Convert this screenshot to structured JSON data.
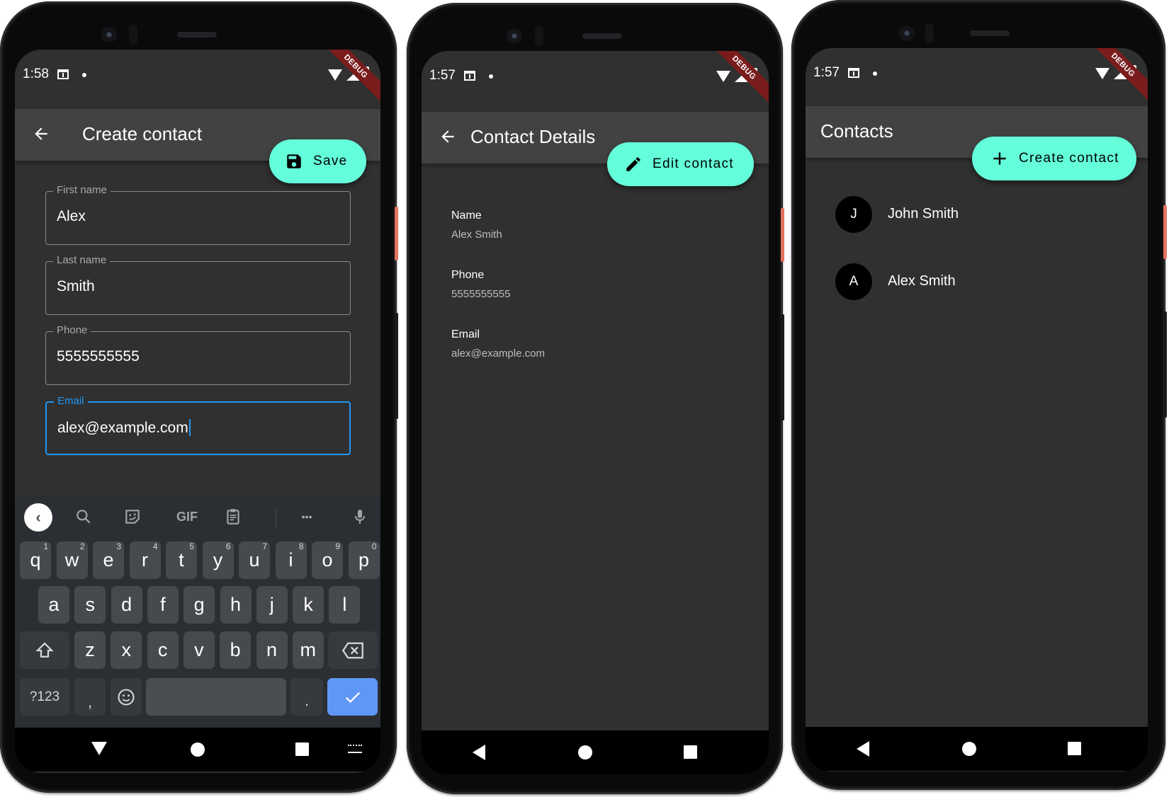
{
  "colors": {
    "accent": "#64ffda",
    "focus": "#2196f3",
    "background": "#303030",
    "appbar": "#424242",
    "debug_banner": "#7a1c1c",
    "keyboard_enter": "#5e97f6"
  },
  "create_screen": {
    "status": {
      "time": "1:58",
      "debug": "DEBUG"
    },
    "appbar": {
      "title": "Create contact",
      "back_icon": "arrow-left-icon"
    },
    "fab": {
      "label": "Save",
      "icon": "save-icon"
    },
    "fields": [
      {
        "label": "First name",
        "value": "Alex"
      },
      {
        "label": "Last name",
        "value": "Smith"
      },
      {
        "label": "Phone",
        "value": "5555555555"
      },
      {
        "label": "Email",
        "value": "alex@example.com",
        "focused": true
      }
    ],
    "keyboard": {
      "toolbar": {
        "gif": "GIF",
        "more": "•••"
      },
      "row1": [
        {
          "k": "q",
          "h": "1"
        },
        {
          "k": "w",
          "h": "2"
        },
        {
          "k": "e",
          "h": "3"
        },
        {
          "k": "r",
          "h": "4"
        },
        {
          "k": "t",
          "h": "5"
        },
        {
          "k": "y",
          "h": "6"
        },
        {
          "k": "u",
          "h": "7"
        },
        {
          "k": "i",
          "h": "8"
        },
        {
          "k": "o",
          "h": "9"
        },
        {
          "k": "p",
          "h": "0"
        }
      ],
      "row2": [
        "a",
        "s",
        "d",
        "f",
        "g",
        "h",
        "j",
        "k",
        "l"
      ],
      "row3": [
        "z",
        "x",
        "c",
        "v",
        "b",
        "n",
        "m"
      ],
      "symbols": "?123",
      "comma": ",",
      "period": "."
    }
  },
  "details_screen": {
    "status": {
      "time": "1:57",
      "debug": "DEBUG"
    },
    "appbar": {
      "title": "Contact Details",
      "back_icon": "arrow-left-icon"
    },
    "fab": {
      "label": "Edit contact",
      "icon": "pencil-icon"
    },
    "items": [
      {
        "label": "Name",
        "value": "Alex Smith"
      },
      {
        "label": "Phone",
        "value": "5555555555"
      },
      {
        "label": "Email",
        "value": "alex@example.com"
      }
    ]
  },
  "list_screen": {
    "status": {
      "time": "1:57",
      "debug": "DEBUG"
    },
    "appbar": {
      "title": "Contacts"
    },
    "fab": {
      "label": "Create contact",
      "icon": "plus-icon"
    },
    "contacts": [
      {
        "initial": "J",
        "name": "John Smith"
      },
      {
        "initial": "A",
        "name": "Alex Smith"
      }
    ]
  }
}
